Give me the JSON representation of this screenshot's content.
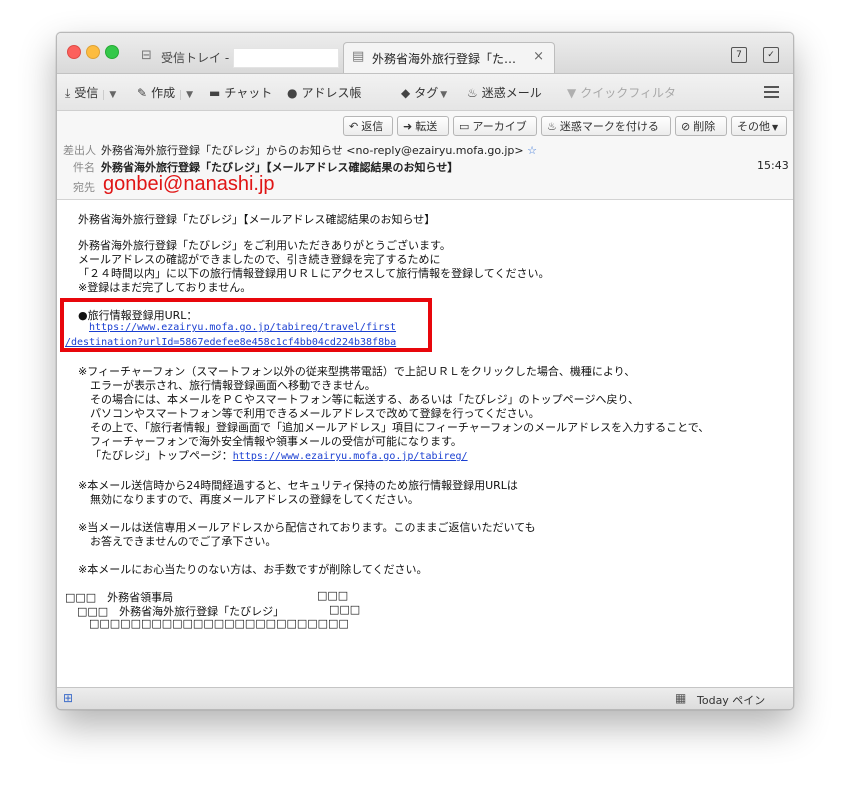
{
  "tabs": [
    {
      "label": "受信トレイ -"
    },
    {
      "label": "外務省海外旅行登録「たび...",
      "close": "×"
    }
  ],
  "toolbar": {
    "get_mail": "受信",
    "write": "作成",
    "chat": "チャット",
    "address_book": "アドレス帳",
    "tag": "タグ",
    "junk": "迷惑メール",
    "quick_filter": "クイックフィルタ"
  },
  "header_buttons": {
    "reply": "返信",
    "forward": "転送",
    "archive": "アーカイブ",
    "mark_junk": "迷惑マークを付ける",
    "delete": "削除",
    "other": "その他"
  },
  "header": {
    "from_label": "差出人",
    "from_value": "外務省海外旅行登録「たびレジ」からのお知らせ <no-reply@ezairyu.mofa.go.jp>",
    "subject_label": "件名",
    "subject_value": "外務省海外旅行登録「たびレジ」【メールアドレス確認結果のお知らせ】",
    "time": "15:43",
    "to_label": "宛先",
    "to_value": "gonbei@nanashi.jp"
  },
  "body": {
    "l1": "外務省海外旅行登録「たびレジ」【メールアドレス確認結果のお知らせ】",
    "l2": "外務省海外旅行登録「たびレジ」をご利用いただきありがとうございます。",
    "l3": "メールアドレスの確認ができましたので、引き続き登録を完了するために",
    "l4": "「２４時間以内」に以下の旅行情報登録用ＵＲＬにアクセスして旅行情報を登録してください。",
    "l5": "※登録はまだ完了しておりません。",
    "url_label": "●旅行情報登録用URL：",
    "url1": "https://www.ezairyu.mofa.go.jp/tabireg/travel/first",
    "url2": "/destination?urlId=5867edefee8e458c1cf4bb04cd224b38f8ba",
    "f1": "※フィーチャーフォン（スマートフォン以外の従来型携帯電話）で上記ＵＲＬをクリックした場合、機種により、",
    "f2": "エラーが表示され、旅行情報登録画面へ移動できません。",
    "f3": "その場合には、本メールをＰＣやスマートフォン等に転送する、あるいは「たびレジ」のトップページへ戻り、",
    "f4": "パソコンやスマートフォン等で利用できるメールアドレスで改めて登録を行ってください。",
    "f5": "その上で、「旅行者情報」登録画面で「追加メールアドレス」項目にフィーチャーフォンのメールアドレスを入力することで、",
    "f6": "フィーチャーフォンで海外安全情報や領事メールの受信が可能になります。",
    "f7_label": "「たびレジ」トップページ：",
    "f7_url": "https://www.ezairyu.mofa.go.jp/tabireg/",
    "n1": "※本メール送信時から24時間経過すると、セキュリティ保持のため旅行情報登録用URLは",
    "n2": "無効になりますので、再度メールアドレスの登録をしてください。",
    "n3": "※当メールは送信専用メールアドレスから配信されております。このままご返信いただいても",
    "n4": "お答えできませんのでご了承下さい。",
    "n5": "※本メールにお心当たりのない方は、お手数ですが削除してください。",
    "s1a": "□□□　外務省領事局",
    "s1b": "□□□",
    "s2a": "□□□　外務省海外旅行登録「たびレジ」",
    "s2b": "□□□",
    "s3": "□□□□□□□□□□□□□□□□□□□□□□□□□"
  },
  "status": {
    "today": "Today ペイン"
  }
}
